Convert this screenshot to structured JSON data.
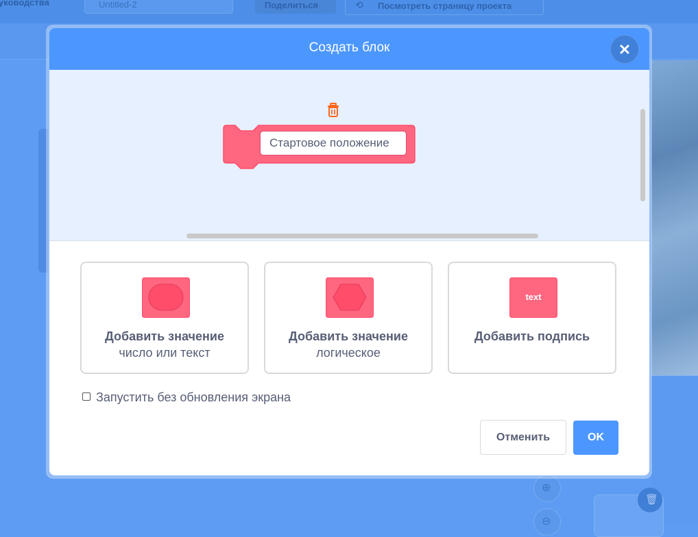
{
  "background": {
    "menu_tutorials": "уководства",
    "project_title": "Untitled-2",
    "share_button": "Поделиться",
    "see_project_page": "Посмотреть страницу проекта"
  },
  "dialog": {
    "title": "Создать блок",
    "close_icon": "close-icon",
    "block_name_value": "Стартовое положение",
    "delete_icon": "trash-icon",
    "options": [
      {
        "title": "Добавить значение",
        "subtitle": "число или текст",
        "icon": "reporter-input-icon"
      },
      {
        "title": "Добавить значение",
        "subtitle": "логическое",
        "icon": "boolean-input-icon"
      },
      {
        "title": "Добавить подпись",
        "subtitle": "",
        "icon": "label-text-icon",
        "icon_text": "text"
      }
    ],
    "run_without_refresh": {
      "label": "Запустить без обновления экрана",
      "checked": false
    },
    "cancel_button": "Отменить",
    "ok_button": "OK"
  },
  "colors": {
    "header": "#4c97ff",
    "block_fill": "#ff6680",
    "block_border": "#ff4d6a",
    "trash": "#ff661a",
    "text": "#575e75"
  }
}
